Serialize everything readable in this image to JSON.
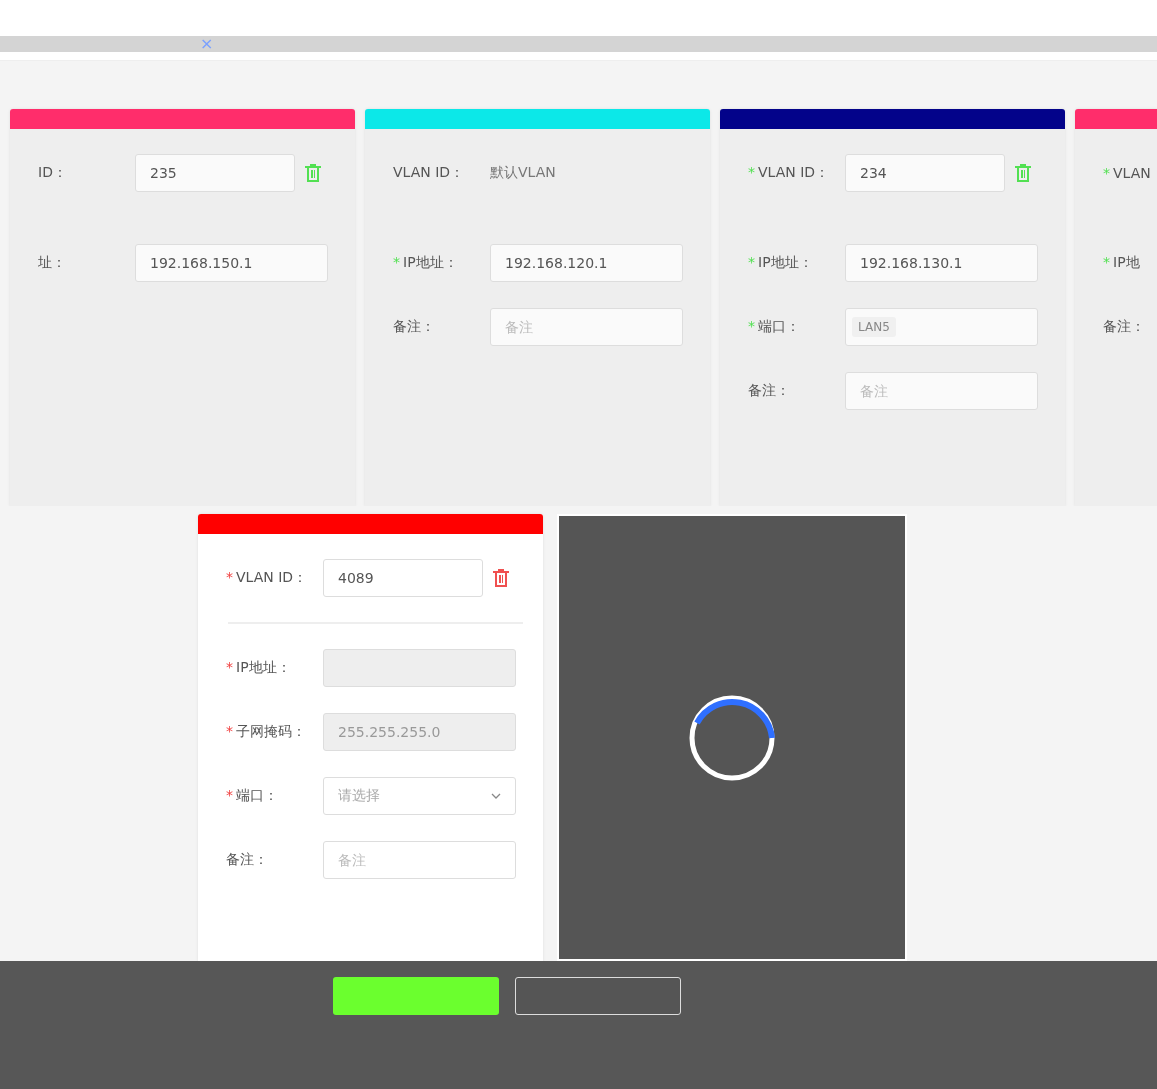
{
  "header": {
    "close_tab": "×"
  },
  "vlan_cards": [
    {
      "color": "#ff2d6b",
      "active": false,
      "fields": [
        {
          "kind": "input",
          "label": "ID：",
          "value": "235",
          "delete_icon": {
            "color": "#52e052"
          }
        },
        {
          "kind": "divider"
        },
        {
          "kind": "input",
          "label": "址：",
          "value": "192.168.150.1"
        }
      ]
    },
    {
      "color": "#0ce8e8",
      "active": false,
      "fields": [
        {
          "kind": "text",
          "label": "VLAN ID：",
          "value": "默认VLAN"
        },
        {
          "kind": "divider"
        },
        {
          "kind": "input",
          "label": "IP地址：",
          "required_mark": "*",
          "value": "192.168.120.1"
        },
        {
          "kind": "input",
          "label": "备注：",
          "placeholder": "备注"
        }
      ]
    },
    {
      "color": "#03038a",
      "active": false,
      "fields": [
        {
          "kind": "input",
          "label": "VLAN ID：",
          "required_mark": "*",
          "value": "234",
          "delete_icon": {
            "color": "#52e052"
          }
        },
        {
          "kind": "divider"
        },
        {
          "kind": "input",
          "label": "IP地址：",
          "required_mark": "*",
          "value": "192.168.130.1"
        },
        {
          "kind": "tags",
          "label": "端口：",
          "required_mark": "*",
          "tags": [
            "LAN5"
          ]
        },
        {
          "kind": "input",
          "label": "备注：",
          "placeholder": "备注"
        }
      ]
    },
    {
      "color": "#ff2d6b",
      "active": false,
      "fields": [
        {
          "kind": "input",
          "label": "VLAN",
          "required_mark": "*"
        },
        {
          "kind": "divider"
        },
        {
          "kind": "input",
          "label": "IP地",
          "required_mark": "*"
        },
        {
          "kind": "input",
          "label": "备注："
        }
      ]
    }
  ],
  "new_card": {
    "color": "#ff0000",
    "active": true,
    "fields": [
      {
        "kind": "input",
        "label": "VLAN ID：",
        "required_mark": "*",
        "value": "4089",
        "delete_icon": {
          "color": "#f05050"
        }
      },
      {
        "kind": "divider"
      },
      {
        "kind": "input",
        "label": "IP地址：",
        "required_mark": "*",
        "disabled": true
      },
      {
        "kind": "input",
        "label": "子网掩码：",
        "required_mark": "*",
        "value": "255.255.255.0",
        "disabled": true
      },
      {
        "kind": "select",
        "label": "端口：",
        "required_mark": "*",
        "placeholder": "请选择"
      },
      {
        "kind": "input",
        "label": "备注：",
        "placeholder": "备注"
      }
    ]
  },
  "loading": {
    "visible": true
  }
}
